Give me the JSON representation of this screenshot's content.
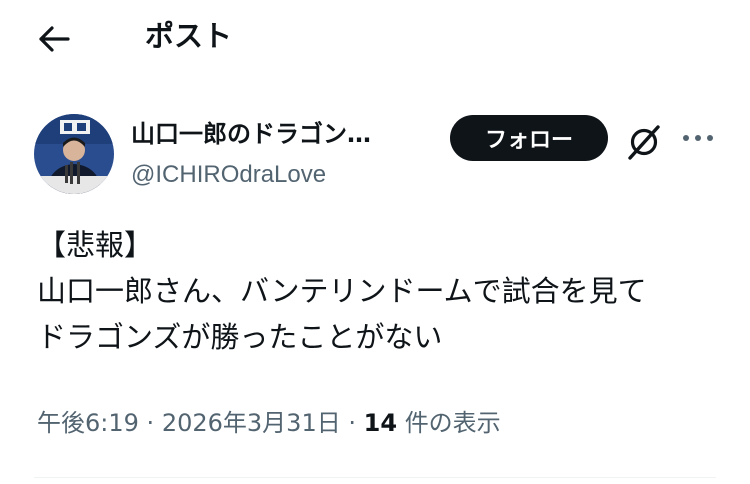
{
  "header": {
    "title": "ポスト",
    "back_icon": "arrow-left-icon"
  },
  "author": {
    "display_name": "山口一郎のドラゴン…",
    "handle": "@ICHIROdraLove"
  },
  "actions": {
    "follow_label": "フォロー",
    "grok_icon": "grok-icon",
    "more_icon": "more-icon"
  },
  "post": {
    "lines": [
      "【悲報】",
      "山口一郎さん、バンテリンドームで試合を見て",
      "ドラゴンズが勝ったことがない"
    ]
  },
  "meta": {
    "time": "午後6:19",
    "separator1": "·",
    "date": "2026年3月31日",
    "separator2": "·",
    "views_count": "14",
    "views_label": "件の表示"
  },
  "colors": {
    "text": "#0f1419",
    "secondary": "#536471",
    "divider": "#eff3f4",
    "follow_bg": "#0f1419"
  }
}
